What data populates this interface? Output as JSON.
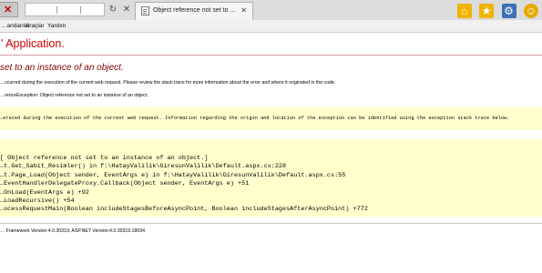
{
  "browser": {
    "tab_title": "Object reference not set to ...",
    "tab_close": "✕",
    "nav": {
      "back_glyph": "◄",
      "refresh_glyph": "↻",
      "close_glyph": "✕"
    },
    "icons": [
      "error-icon",
      "page-icon",
      "home-icon",
      "star-icon",
      "gear-icon",
      "smiley-icon"
    ],
    "menu": [
      "…andanlar",
      "Araçlar",
      "Yardım"
    ]
  },
  "page": {
    "app_title": "' Application.",
    "error_heading": "set to an instance of an object.",
    "description": "…ccurred during the execution of the current web request. Please review the stack trace for more information about the error and where it originated in the code.",
    "exception_details": "…renceException: Object reference not set to an instance of an object.",
    "source_error": "…erated during the execution of the current web request. Information regarding the origin and location of the exception can be identified using the exception stack trace below.",
    "stack_trace": [
      "[ Object reference not set to an instance of an object.]",
      "…t.Get_Sabit_Resimler() in f:\\HatayValilik\\GiresunValilik\\Default.aspx.cs:228",
      "…t.Page_Load(Object sender, EventArgs e) in f:\\HatayValilik\\GiresunValilik\\Default.aspx.cs:55",
      "…EventHandlerDelegateProxy.Callback(Object sender, EventArgs e) +51",
      "…OnLoad(EventArgs e) +92",
      "…LoadRecursive() +54",
      "…ocessRequestMain(Boolean includeStagesBeforeAsyncPoint, Boolean includeStagesAfterAsyncPoint) +772"
    ],
    "version_info": "… Framework Version:4.0.30319; ASP.NET Version:4.0.30319.18034"
  },
  "colors": {
    "title_red": "#cc0000",
    "heading_maroon": "#800000",
    "yellow_box": "#ffffcc"
  }
}
